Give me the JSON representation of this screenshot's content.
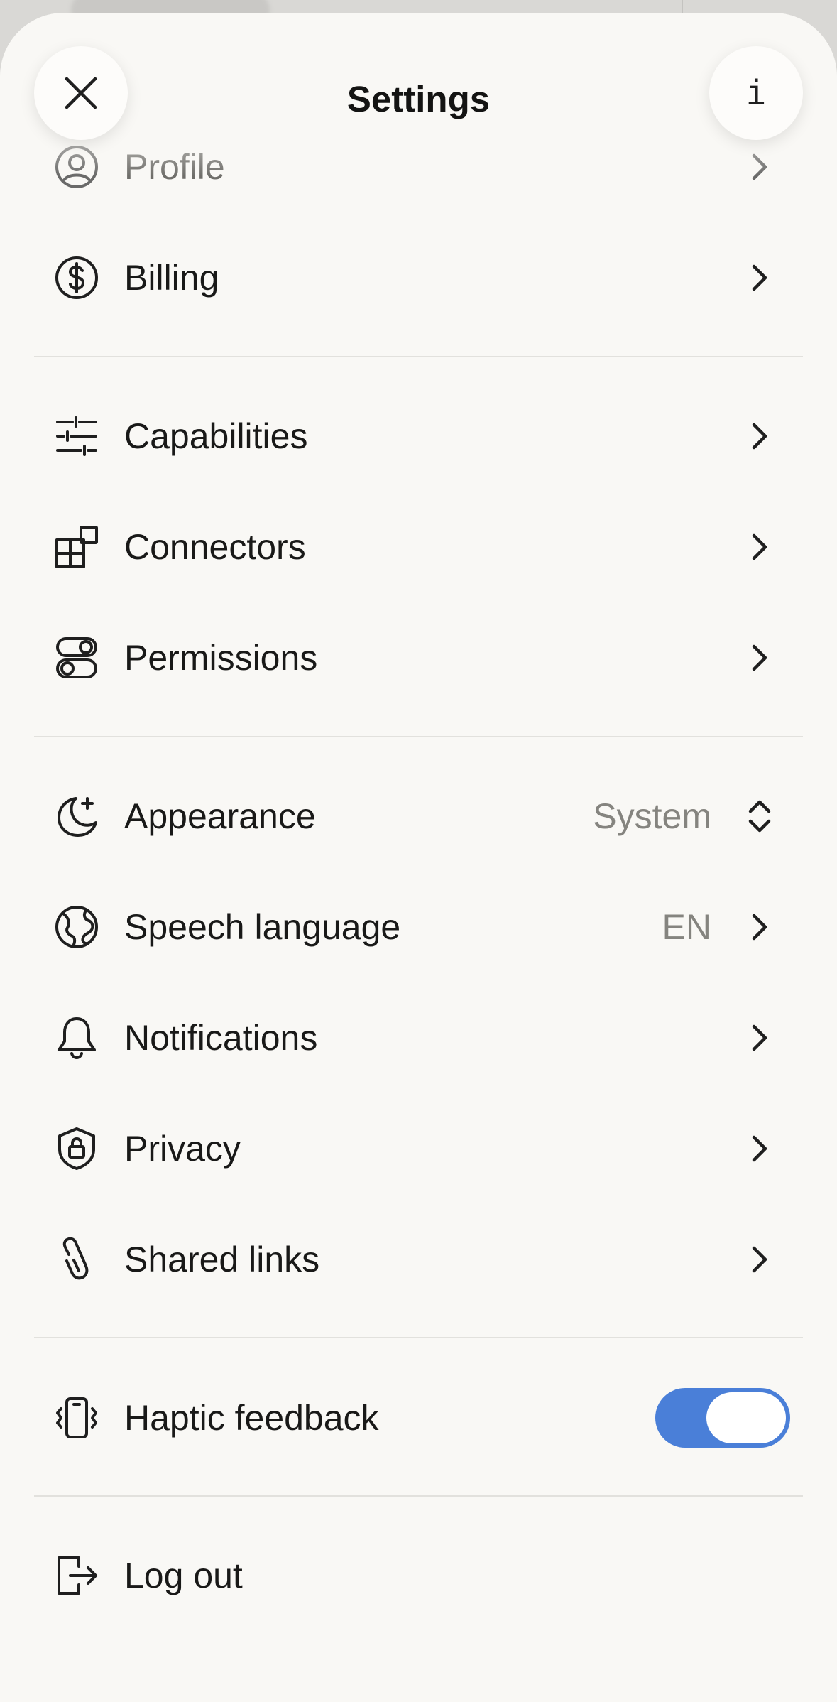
{
  "header": {
    "title": "Settings",
    "close_icon": "close-icon",
    "info_glyph": "i"
  },
  "groups": {
    "account": [
      {
        "label": "Profile",
        "icon": "person-circle-icon"
      },
      {
        "label": "Billing",
        "icon": "dollar-circle-icon"
      }
    ],
    "features": [
      {
        "label": "Capabilities",
        "icon": "sliders-icon"
      },
      {
        "label": "Connectors",
        "icon": "blocks-icon"
      },
      {
        "label": "Permissions",
        "icon": "toggles-icon"
      }
    ],
    "preferences": [
      {
        "label": "Appearance",
        "icon": "moon-sparkle-icon",
        "value": "System",
        "control": "chevron-up-down-icon"
      },
      {
        "label": "Speech language",
        "icon": "globe-icon",
        "value": "EN"
      },
      {
        "label": "Notifications",
        "icon": "bell-icon"
      },
      {
        "label": "Privacy",
        "icon": "shield-lock-icon"
      },
      {
        "label": "Shared links",
        "icon": "paperclip-icon"
      }
    ],
    "haptics": {
      "label": "Haptic feedback",
      "icon": "phone-vibrate-icon",
      "enabled": true
    },
    "session": {
      "label": "Log out",
      "icon": "log-out-icon"
    }
  },
  "colors": {
    "background": "#f9f8f5",
    "toggle_on": "#4a7fd8",
    "secondary_text": "#85847f"
  }
}
